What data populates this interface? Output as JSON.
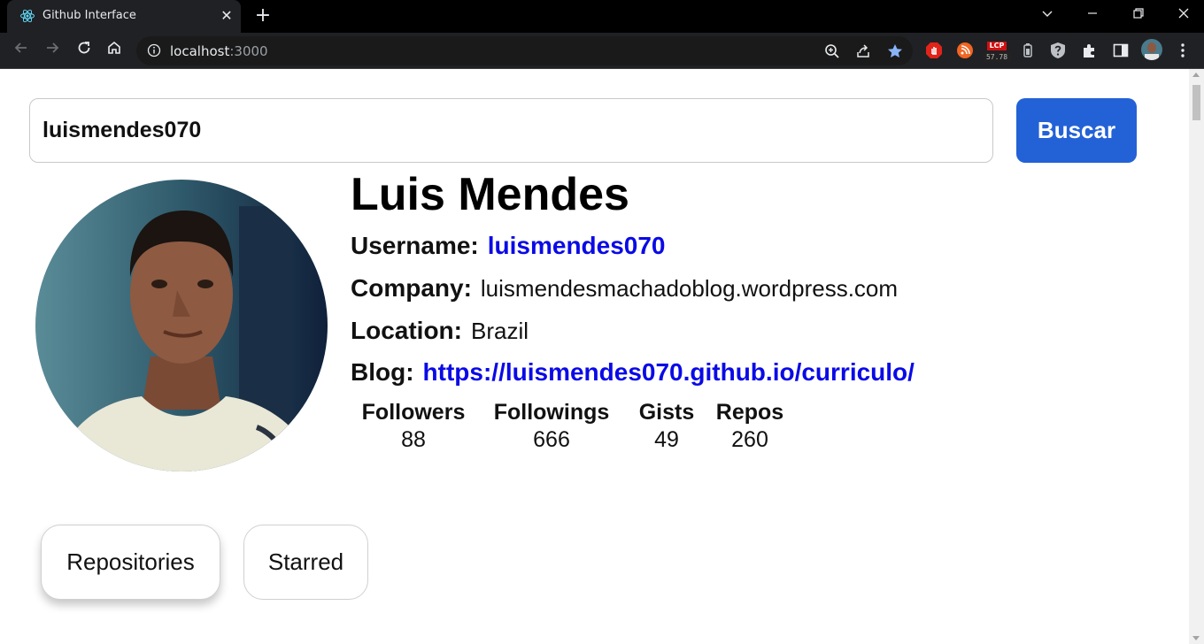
{
  "browser": {
    "tab_title": "Github Interface",
    "tab_close": "✕",
    "new_tab": "+",
    "url_host": "localhost",
    "url_port": ":3000",
    "lcp_badge": "LCP",
    "lcp_value": "57.78"
  },
  "search": {
    "value": "luismendes070",
    "button_label": "Buscar"
  },
  "profile": {
    "name": "Luis Mendes",
    "username_label": "Username:",
    "username": "luismendes070",
    "company_label": "Company:",
    "company": "luismendesmachadoblog.wordpress.com",
    "location_label": "Location:",
    "location": "Brazil",
    "blog_label": "Blog:",
    "blog": "https://luismendes070.github.io/curriculo/"
  },
  "stats": [
    {
      "label": "Followers",
      "value": "88"
    },
    {
      "label": "Followings",
      "value": "666"
    },
    {
      "label": "Gists",
      "value": "49"
    },
    {
      "label": "Repos",
      "value": "260"
    }
  ],
  "tabs": {
    "repositories": "Repositories",
    "starred": "Starred"
  },
  "colors": {
    "accent": "#2361d7",
    "link": "#0a0ae6"
  }
}
